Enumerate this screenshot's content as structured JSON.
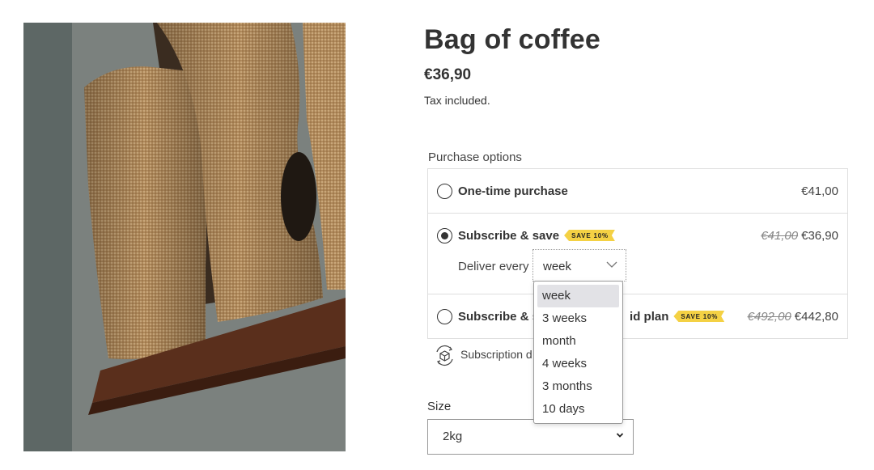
{
  "product": {
    "title": "Bag of coffee",
    "price": "€36,90",
    "tax_note": "Tax included."
  },
  "purchase_options": {
    "label": "Purchase options",
    "one_time": {
      "label": "One-time purchase",
      "price": "€41,00",
      "selected": false
    },
    "subscribe": {
      "label": "Subscribe & save",
      "badge": "SAVE 10%",
      "original_price": "€41,00",
      "price": "€36,90",
      "selected": true,
      "deliver_label": "Deliver every",
      "deliver_value": "week"
    },
    "prepaid": {
      "label_start": "Subscribe & s",
      "label_end": "id plan",
      "badge": "SAVE 10%",
      "original_price": "€492,00",
      "price": "€442,80",
      "selected": false
    },
    "subscription_details": "Subscription d"
  },
  "deliver_dropdown": {
    "options": [
      "week",
      "3 weeks",
      "month",
      "4 weeks",
      "3 months",
      "10 days"
    ],
    "highlighted": "week"
  },
  "size": {
    "label": "Size",
    "value": "2kg"
  },
  "colors": {
    "text": "#333333",
    "badge": "#f4d144",
    "border": "#dedede"
  }
}
